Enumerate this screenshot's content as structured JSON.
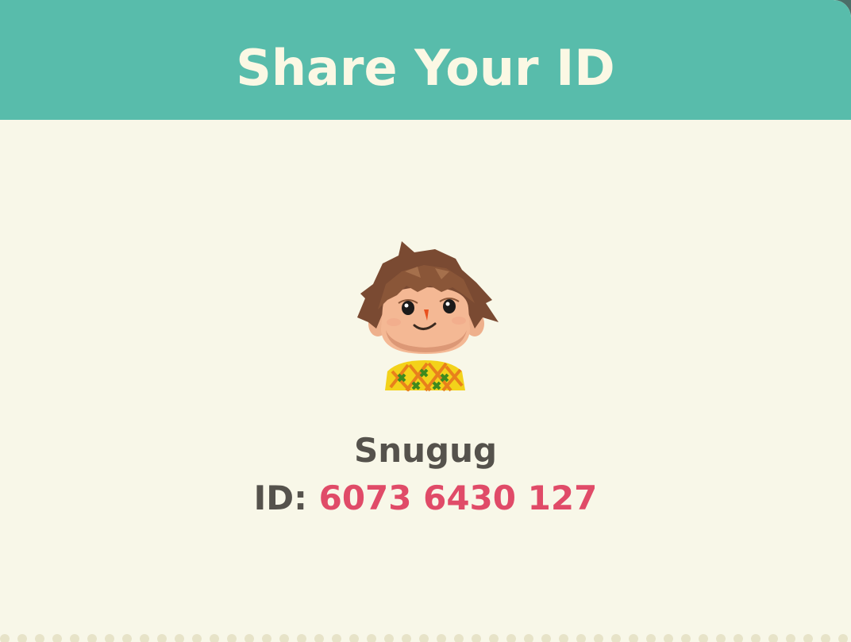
{
  "header": {
    "title": "Share Your ID"
  },
  "player": {
    "name": "Snugug",
    "id_label": "ID:",
    "id_value": "6073 6430 127",
    "avatar_icon": "villager-avatar-icon"
  },
  "colors": {
    "header_bg": "#58bcab",
    "title_text": "#fbf8e4",
    "card_bg": "#f8f7e8",
    "text": "#55524c",
    "id_value": "#e04b68"
  }
}
